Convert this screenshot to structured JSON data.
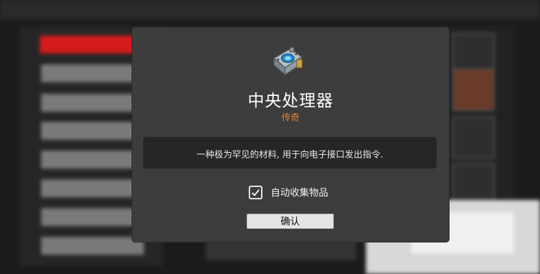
{
  "item": {
    "name": "中央处理器",
    "rarity": "传奇",
    "description": "一种极为罕见的材料, 用于向电子接口发出指令.",
    "icon": "cpu-chip-icon"
  },
  "auto_collect": {
    "label": "自动收集物品",
    "checked": true
  },
  "confirm_button": {
    "label": "确认"
  },
  "colors": {
    "rarity": "#e4872f",
    "dialog_bg": "#3a3a3a",
    "desc_bg": "#262626"
  }
}
